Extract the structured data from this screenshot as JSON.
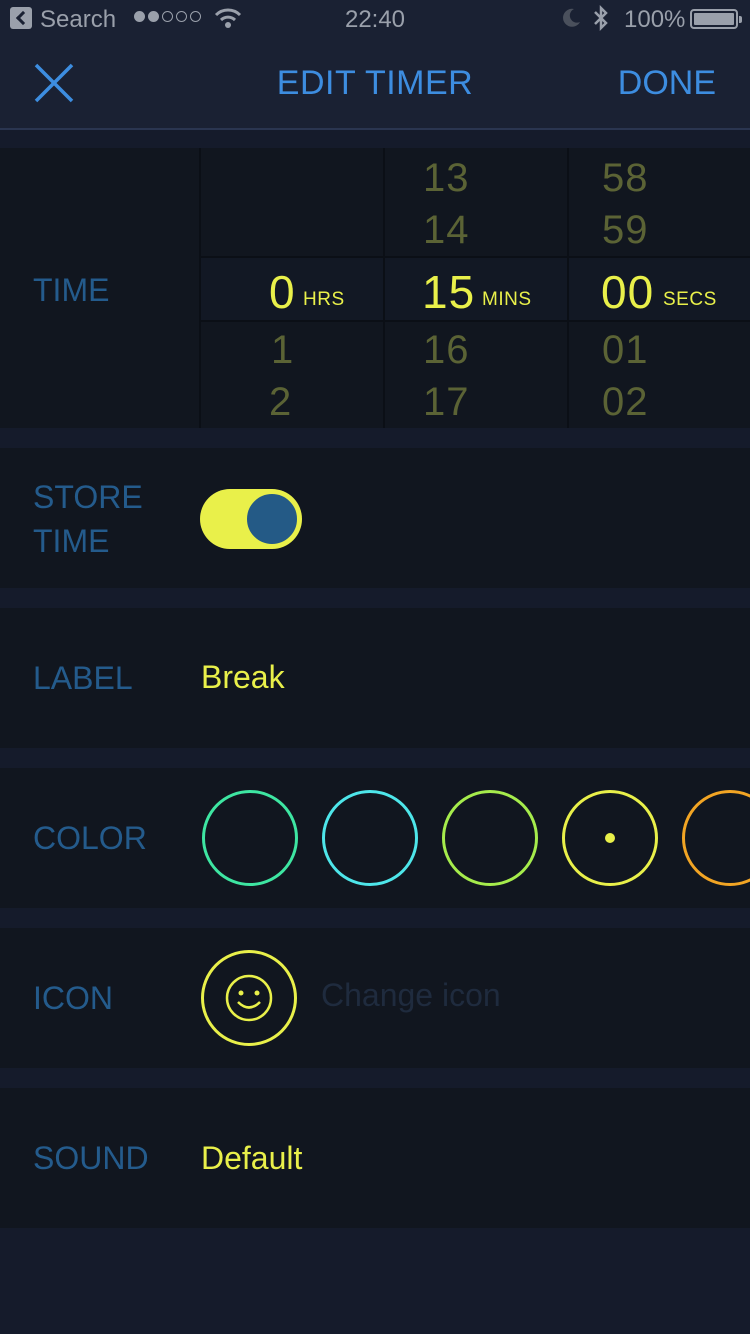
{
  "status_bar": {
    "back_app": "Search",
    "time": "22:40",
    "battery": "100%"
  },
  "nav": {
    "title": "EDIT TIMER",
    "done": "DONE"
  },
  "time": {
    "label": "TIME",
    "hours": {
      "above": [
        "",
        ""
      ],
      "selected": "0",
      "below": [
        "1",
        "2"
      ],
      "unit": "HRS"
    },
    "minutes": {
      "above": [
        "13",
        "14"
      ],
      "selected": "15",
      "below": [
        "16",
        "17"
      ],
      "unit": "MINS"
    },
    "seconds": {
      "above": [
        "58",
        "59"
      ],
      "selected": "00",
      "below": [
        "01",
        "02"
      ],
      "unit": "SECS"
    }
  },
  "store_time": {
    "label_line1": "STORE",
    "label_line2": "TIME",
    "enabled": true
  },
  "label_row": {
    "label": "LABEL",
    "value": "Break"
  },
  "color_row": {
    "label": "COLOR",
    "swatches": [
      "#3ee6a2",
      "#4ee6ea",
      "#a6ec4c",
      "#e9f04a",
      "#f2a524"
    ],
    "selected_index": 3
  },
  "icon_row": {
    "label": "ICON",
    "icon": "smiley-icon",
    "action": "Change icon"
  },
  "sound_row": {
    "label": "SOUND",
    "value": "Default"
  },
  "colors": {
    "accent_yellow": "#e9f04a",
    "label_blue": "#245b8c",
    "nav_blue": "#3d8de0"
  }
}
